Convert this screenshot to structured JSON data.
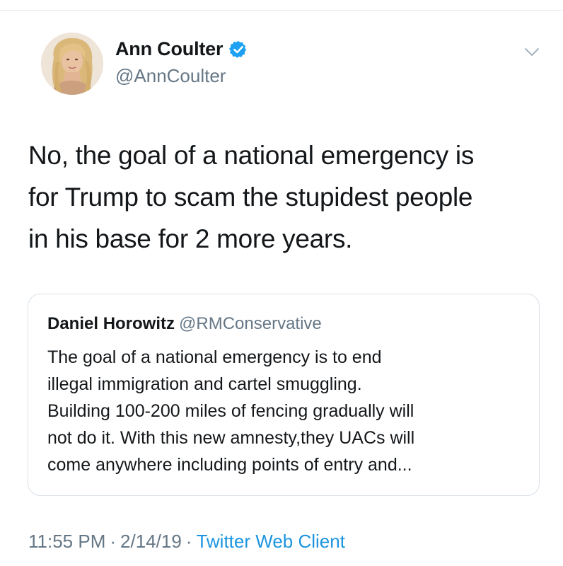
{
  "author": {
    "display_name": "Ann Coulter",
    "handle": "@AnnCoulter",
    "verified": true,
    "verified_color": "#1da1f2"
  },
  "tweet": {
    "lines": [
      "No, the goal of a national emergency is",
      "for Trump to scam the stupidest people",
      "in his base for 2 more years."
    ]
  },
  "quoted_tweet": {
    "display_name": "Daniel Horowitz",
    "handle": "@RMConservative",
    "lines": [
      "The goal of a national emergency is to end",
      "illegal immigration and cartel smuggling.",
      "Building 100-200 miles of fencing gradually will",
      "not do it. With this new amnesty,they UACs will",
      "come anywhere including points of entry and..."
    ]
  },
  "meta": {
    "time": "11:55 PM",
    "separator": "·",
    "date": "2/14/19",
    "client": "Twitter Web Client",
    "client_color": "#1b95e0"
  },
  "icons": {
    "verified": "verified-badge-icon",
    "menu": "chevron-down-icon"
  }
}
